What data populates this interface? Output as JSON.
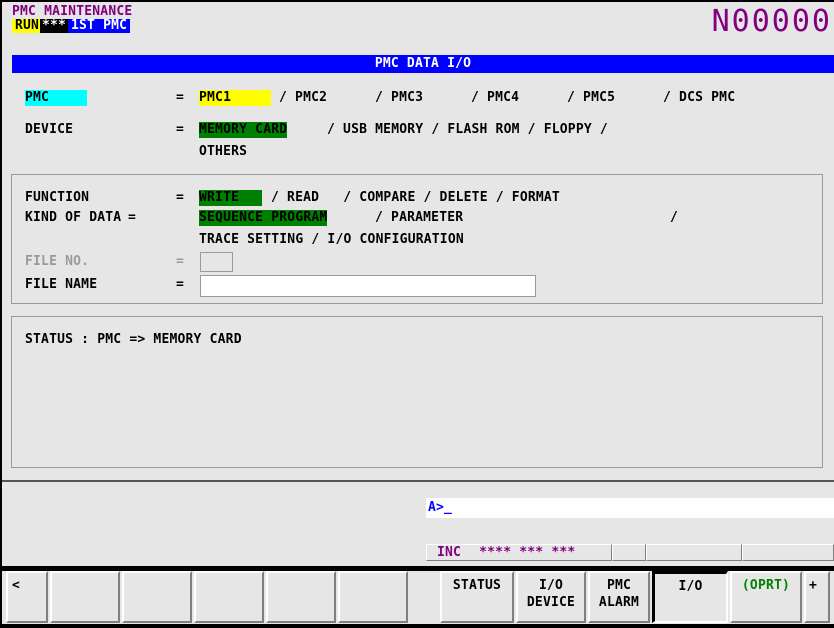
{
  "header": {
    "title": "PMC MAINTENANCE",
    "run": "RUN",
    "stars": "***",
    "pmc": "1ST PMC",
    "program_number": "N00000"
  },
  "screen_title": "PMC DATA I/O",
  "pmc_row": {
    "label": "PMC",
    "eq": "=",
    "selected": "PMC1",
    "options": [
      "/ PMC2",
      "/ PMC3",
      "/ PMC4",
      "/ PMC5",
      "/ DCS PMC"
    ]
  },
  "device_row": {
    "label": "DEVICE",
    "eq": "=",
    "selected": "MEMORY CARD",
    "options_line1": "/ USB MEMORY / FLASH ROM / FLOPPY /",
    "options_line2": "OTHERS"
  },
  "function_row": {
    "label": "FUNCTION",
    "eq": "=",
    "selected": "WRITE",
    "options": "/ READ   / COMPARE / DELETE / FORMAT"
  },
  "kind_row": {
    "label": "KIND OF DATA",
    "eq": "=",
    "selected": "SEQUENCE PROGRAM",
    "options_line1": "/ PARAMETER",
    "trailing_slash": "/",
    "options_line2": "TRACE SETTING / I/O CONFIGURATION"
  },
  "file_no": {
    "label": "FILE NO.",
    "eq": "=",
    "value": ""
  },
  "file_name": {
    "label": "FILE NAME",
    "eq": "=",
    "value": ""
  },
  "status_text": "STATUS : PMC => MEMORY CARD",
  "input_prompt": "A>_",
  "status_bar": {
    "mode": "INC",
    "stars": "**** *** ***"
  },
  "softkeys": {
    "left_arrow": "<",
    "status": "STATUS",
    "io_device_l1": "I/O",
    "io_device_l2": "DEVICE",
    "pmc_alarm_l1": "PMC",
    "pmc_alarm_l2": "ALARM",
    "io": "I/O",
    "oprt": "(OPRT)",
    "plus": "+"
  },
  "colors": {
    "background": "#e6e6e6",
    "title_purple": "#800080",
    "title_bar_blue": "#0000ff",
    "highlight_yellow": "#ffff00",
    "highlight_cyan": "#00ffff",
    "highlight_green": "#008000"
  }
}
